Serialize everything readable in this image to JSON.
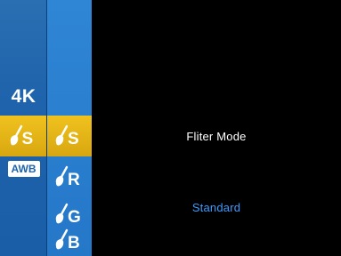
{
  "menu": {
    "resolution_label": "4K",
    "filter_letter": "S",
    "awb_label": "AWB"
  },
  "submenu": {
    "options": [
      {
        "letter": "S",
        "selected": true
      },
      {
        "letter": "R",
        "selected": false
      },
      {
        "letter": "G",
        "selected": false
      },
      {
        "letter": "B",
        "selected": false
      }
    ]
  },
  "panel": {
    "title": "Fliter Mode",
    "value": "Standard"
  },
  "colors": {
    "highlight": "#f0c21e",
    "menu_blue": "#1e63ab",
    "value_blue": "#3b9bff"
  },
  "icons": [
    "filter-brush-icon"
  ]
}
